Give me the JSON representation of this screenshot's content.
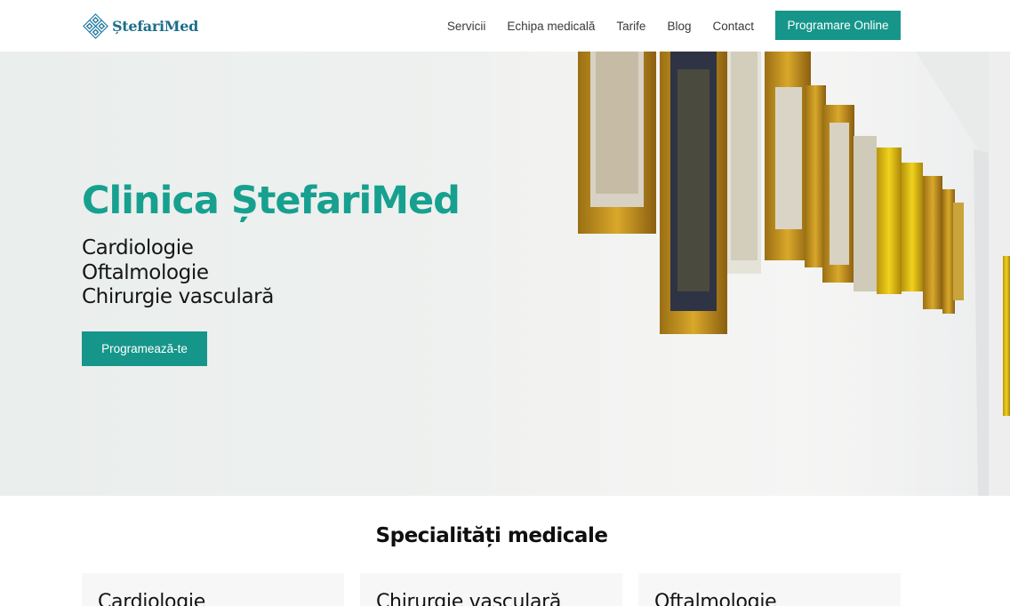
{
  "header": {
    "logo_text": "ȘtefariMed",
    "nav": [
      {
        "label": "Servicii"
      },
      {
        "label": "Echipa medicală"
      },
      {
        "label": "Tarife"
      },
      {
        "label": "Blog"
      },
      {
        "label": "Contact"
      }
    ],
    "cta_label": "Programare Online"
  },
  "hero": {
    "title": "Clinica ȘtefariMed",
    "specialties": [
      "Cardiologie",
      "Oftalmologie",
      "Chirurgie vasculară"
    ],
    "button_label": "Programează-te"
  },
  "specialties_section": {
    "title": "Specialități medicale",
    "cards": [
      {
        "title": "Cardiologie"
      },
      {
        "title": "Chirurgie vasculară"
      },
      {
        "title": "Oftalmologie"
      }
    ]
  },
  "colors": {
    "accent": "#16968a",
    "title_teal": "#17a08f",
    "logo_blue": "#1c6f8a"
  },
  "icons": [
    "logo-diamond-icon"
  ]
}
